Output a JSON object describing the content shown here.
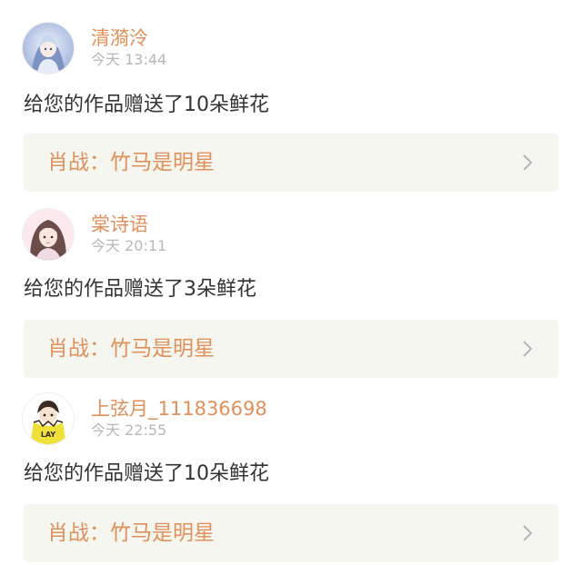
{
  "feed": {
    "items": [
      {
        "username": "清漪泠",
        "time": "今天 13:44",
        "message": "给您的作品赠送了10朵鲜花",
        "work_title": "肖战：竹马是明星",
        "avatar_icon": "anime-girl-avatar-icon",
        "avatar_palette": [
          "#c9d8ef",
          "#7d93c4",
          "#f2f4fb"
        ]
      },
      {
        "username": "棠诗语",
        "time": "今天 20:11",
        "message": "给您的作品赠送了3朵鲜花",
        "work_title": "肖战：竹马是明星",
        "avatar_icon": "anime-girl-avatar-icon",
        "avatar_palette": [
          "#f3dbe6",
          "#6c4d4a",
          "#fbe9ee"
        ]
      },
      {
        "username": "上弦月_111836698",
        "time": "今天 22:55",
        "message": "给您的作品赠送了10朵鲜花",
        "work_title": "肖战：竹马是明星",
        "avatar_icon": "cartoon-boy-avatar-icon",
        "avatar_badge": "LAY",
        "avatar_palette": [
          "#f0e03a",
          "#3a2a22",
          "#ffffff"
        ]
      }
    ]
  }
}
